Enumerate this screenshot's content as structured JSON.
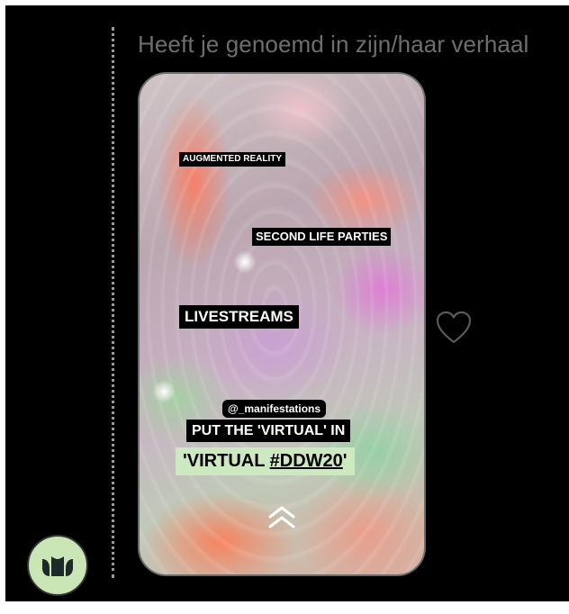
{
  "reply": {
    "caption": "Heeft je genoemd in zijn/haar verhaal"
  },
  "story": {
    "stickers": {
      "augmented": "AUGMENTED REALITY",
      "second_life": "SECOND LIFE PARTIES",
      "livestreams": "LIVESTREAMS",
      "mention": "@_manifestations",
      "put_the": "PUT THE 'VIRTUAL' IN",
      "virtual_prefix": "'VIRTUAL ",
      "hashtag": "#DDW20",
      "virtual_suffix": "'"
    },
    "swipe_icon": "chevron-double-up-icon"
  },
  "actions": {
    "like_icon": "heart-icon"
  },
  "sender": {
    "avatar_icon": "manifestations-logo-icon",
    "avatar_color": "#cbe6b6"
  },
  "colors": {
    "background": "#000000",
    "caption": "#6e6e6e",
    "hashtag_bg": "#cde9bf"
  }
}
